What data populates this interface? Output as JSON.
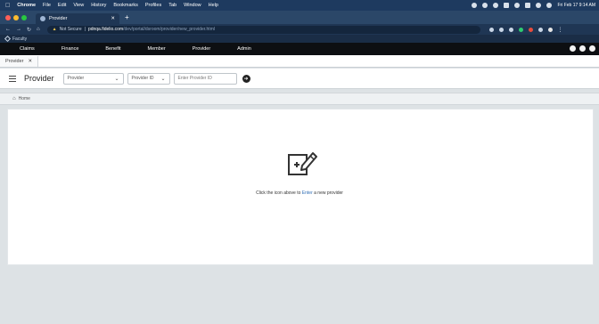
{
  "macos_menubar": {
    "items": [
      "Chrome",
      "File",
      "Edit",
      "View",
      "History",
      "Bookmarks",
      "Profiles",
      "Tab",
      "Window",
      "Help"
    ],
    "clock": "Fri Feb 17 9:14 AM"
  },
  "browser": {
    "tab_title": "Provider",
    "new_tab": "+",
    "url_security": "Not Secure",
    "url_host": "pdnqa.fidelio.com",
    "url_path": "/dev/portal/dsroom/provider/new_provider.html",
    "bookmark": "Faculty"
  },
  "app_nav": {
    "items": [
      "Claims",
      "Finance",
      "Benefit",
      "Member",
      "Provider",
      "Admin"
    ]
  },
  "subtabs": [
    {
      "label": "Provider",
      "close": "✕"
    }
  ],
  "toolbar": {
    "title": "Provider",
    "entity_select": "Provider",
    "id_select": "Provider ID",
    "search_placeholder": "Enter Provider ID",
    "go_icon": "arrow-right-icon"
  },
  "breadcrumb": {
    "home": "Home"
  },
  "empty_state": {
    "message_before": "Click the icon above to ",
    "message_link": "Enter",
    "message_after": " a new provider",
    "icon": "edit-add-icon"
  }
}
